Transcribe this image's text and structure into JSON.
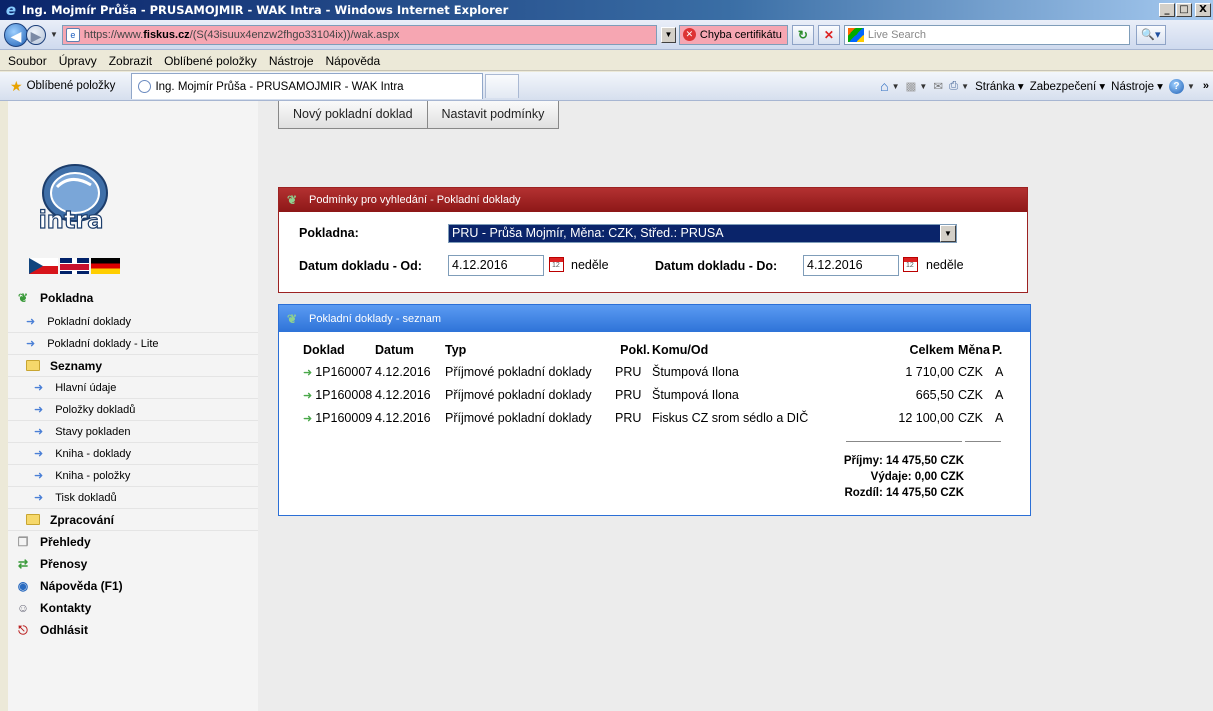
{
  "window": {
    "title": "Ing. Mojmír Průša - PRUSAMOJMIR - WAK Intra - Windows Internet Explorer",
    "controls": [
      "_",
      "□",
      "X"
    ]
  },
  "address_bar": {
    "url_prefix": "https://www.",
    "url_domain": "fiskus.cz",
    "url_path": "/(S(43isuux4enzw2fhgo33104ix))/wak.aspx",
    "cert_error": "Chyba certifikátu",
    "search_placeholder": "Live Search"
  },
  "menu": [
    "Soubor",
    "Úpravy",
    "Zobrazit",
    "Oblíbené položky",
    "Nástroje",
    "Nápověda"
  ],
  "favorites": {
    "label": "Oblíbené položky",
    "tab_title": "Ing. Mojmír Průša - PRUSAMOJMIR - WAK Intra"
  },
  "command_bar": {
    "page": "Stránka",
    "security": "Zabezpečení",
    "tools": "Nástroje"
  },
  "logo_text": "intra",
  "sidebar": {
    "pokladna": "Pokladna",
    "items": [
      "Pokladní doklady",
      "Pokladní doklady - Lite"
    ],
    "seznamy": "Seznamy",
    "sub_items": [
      "Hlavní údaje",
      "Položky dokladů",
      "Stavy pokladen",
      "Kniha - doklady",
      "Kniha - položky",
      "Tisk dokladů"
    ],
    "zpracovani": "Zpracování",
    "bottom": [
      "Přehledy",
      "Přenosy",
      "Nápověda (F1)",
      "Kontakty",
      "Odhlásit"
    ]
  },
  "toolbar": {
    "new_doc": "Nový pokladní doklad",
    "set_conditions": "Nastavit podmínky"
  },
  "search_panel": {
    "title": "Podmínky pro vyhledání - Pokladní doklady",
    "pokladna_label": "Pokladna:",
    "pokladna_value": "PRU - Průša Mojmír, Měna: CZK, Střed.: PRUSA",
    "date_from_label": "Datum dokladu - Od:",
    "date_from_value": "4.12.2016",
    "date_from_day": "neděle",
    "date_to_label": "Datum dokladu - Do:",
    "date_to_value": "4.12.2016",
    "date_to_day": "neděle"
  },
  "list_panel": {
    "title": "Pokladní doklady - seznam",
    "headers": {
      "doklad": "Doklad",
      "datum": "Datum",
      "typ": "Typ",
      "pokl": "Pokl.",
      "komu": "Komu/Od",
      "celkem": "Celkem",
      "mena": "Měna",
      "p": "P."
    },
    "rows": [
      {
        "doklad": "1P160007",
        "datum": "4.12.2016",
        "typ": "Příjmové pokladní doklady",
        "pokl": "PRU",
        "komu": "Štumpová Ilona",
        "celkem": "1 710,00",
        "mena": "CZK",
        "p": "A"
      },
      {
        "doklad": "1P160008",
        "datum": "4.12.2016",
        "typ": "Příjmové pokladní doklady",
        "pokl": "PRU",
        "komu": "Štumpová Ilona",
        "celkem": "665,50",
        "mena": "CZK",
        "p": "A"
      },
      {
        "doklad": "1P160009",
        "datum": "4.12.2016",
        "typ": "Příjmové pokladní doklady",
        "pokl": "PRU",
        "komu": "Fiskus CZ srom sédlo a DIČ",
        "celkem": "12 100,00",
        "mena": "CZK",
        "p": "A"
      }
    ],
    "summary": {
      "prijmy": "Příjmy: 14 475,50",
      "vydaje": "Výdaje: 0,00",
      "rozdil": "Rozdíl: 14 475,50",
      "currency": "CZK"
    }
  }
}
